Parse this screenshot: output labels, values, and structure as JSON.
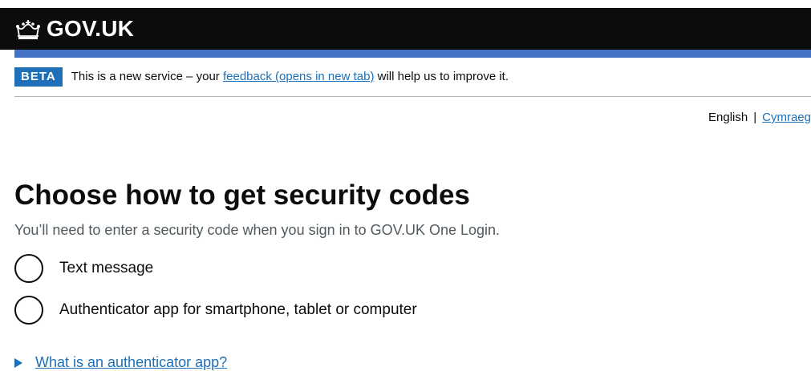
{
  "header": {
    "logo_text": "GOV.UK",
    "logo_icon": "crown-icon",
    "bg_color": "#0b0c0c",
    "bar_color": "#4473c4"
  },
  "phase_banner": {
    "tag": "BETA",
    "text_before": "This is a new service – your ",
    "link_text": "feedback (opens in new tab)",
    "text_after": " will help us to improve it."
  },
  "language": {
    "current": "English",
    "separator": "|",
    "alternate": "Cymraeg"
  },
  "main": {
    "heading": "Choose how to get security codes",
    "hint": "You’ll need to enter a security code when you sign in to GOV.UK One Login.",
    "options": [
      {
        "label": "Text message",
        "selected": false
      },
      {
        "label": "Authenticator app for smartphone, tablet or computer",
        "selected": false
      }
    ],
    "details_summary": "What is an authenticator app?"
  },
  "colors": {
    "link": "#1d70b8",
    "text": "#0b0c0c",
    "hint": "#505a5f"
  }
}
